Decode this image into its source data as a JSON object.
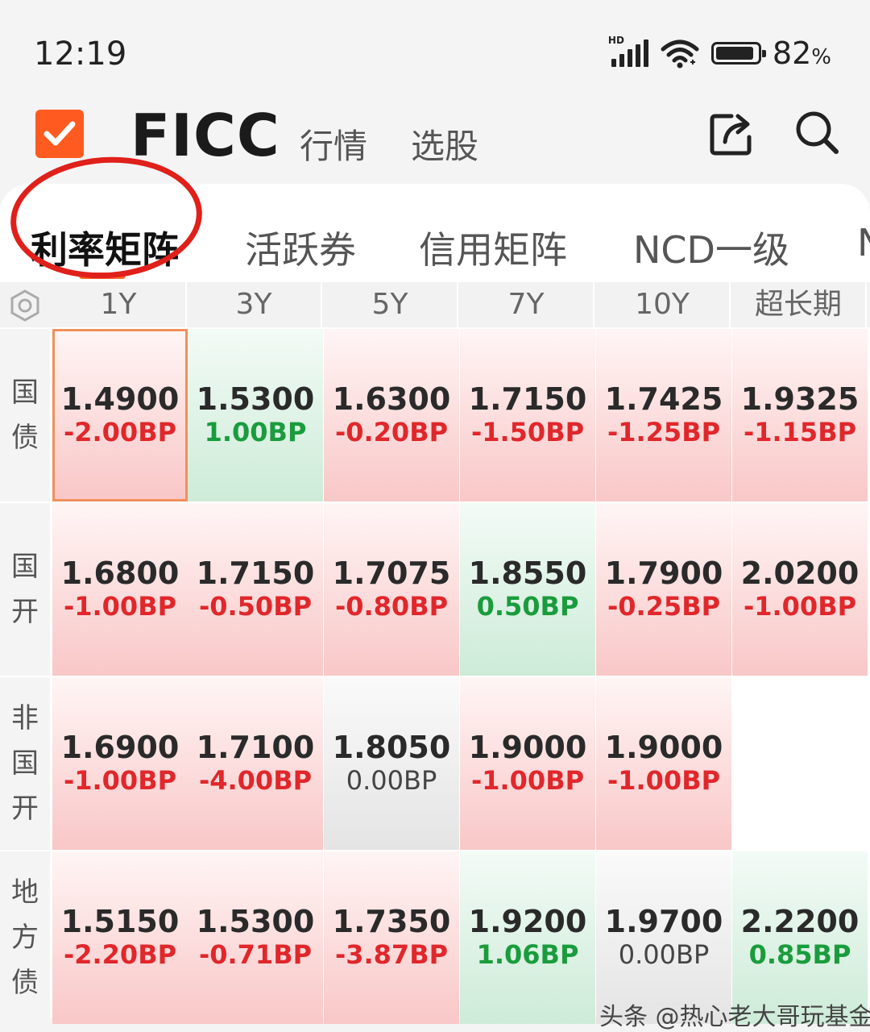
{
  "status_bar": {
    "time": "12:19",
    "network": "HD",
    "battery": "82",
    "battery_unit": "%"
  },
  "header": {
    "title": "FICC",
    "tabs": [
      "行情",
      "选股"
    ]
  },
  "subtabs": [
    {
      "label": "利率矩阵"
    },
    {
      "label": "活跃券"
    },
    {
      "label": "信用矩阵"
    },
    {
      "label": "NCD一级"
    },
    {
      "label": "N"
    }
  ],
  "matrix": {
    "columns": [
      "1Y",
      "3Y",
      "5Y",
      "7Y",
      "10Y",
      "超长期"
    ],
    "rows": [
      {
        "label": [
          "国",
          "债"
        ],
        "cells": [
          {
            "value": "1.4900",
            "change": "-2.00BP",
            "tone": "red"
          },
          {
            "value": "1.5300",
            "change": "1.00BP",
            "tone": "green"
          },
          {
            "value": "1.6300",
            "change": "-0.20BP",
            "tone": "red"
          },
          {
            "value": "1.7150",
            "change": "-1.50BP",
            "tone": "red"
          },
          {
            "value": "1.7425",
            "change": "-1.25BP",
            "tone": "red"
          },
          {
            "value": "1.9325",
            "change": "-1.15BP",
            "tone": "red"
          }
        ]
      },
      {
        "label": [
          "国",
          "开"
        ],
        "cells": [
          {
            "value": "1.6800",
            "change": "-1.00BP",
            "tone": "red"
          },
          {
            "value": "1.7150",
            "change": "-0.50BP",
            "tone": "red"
          },
          {
            "value": "1.7075",
            "change": "-0.80BP",
            "tone": "red"
          },
          {
            "value": "1.8550",
            "change": "0.50BP",
            "tone": "green"
          },
          {
            "value": "1.7900",
            "change": "-0.25BP",
            "tone": "red"
          },
          {
            "value": "2.0200",
            "change": "-1.00BP",
            "tone": "red"
          }
        ]
      },
      {
        "label": [
          "非",
          "国",
          "开"
        ],
        "cells": [
          {
            "value": "1.6900",
            "change": "-1.00BP",
            "tone": "red"
          },
          {
            "value": "1.7100",
            "change": "-4.00BP",
            "tone": "red"
          },
          {
            "value": "1.8050",
            "change": "0.00BP",
            "tone": "grey"
          },
          {
            "value": "1.9000",
            "change": "-1.00BP",
            "tone": "red"
          },
          {
            "value": "1.9000",
            "change": "-1.00BP",
            "tone": "red"
          },
          {
            "value": "",
            "change": "",
            "tone": "empty"
          }
        ]
      },
      {
        "label": [
          "地",
          "方",
          "债"
        ],
        "cells": [
          {
            "value": "1.5150",
            "change": "-2.20BP",
            "tone": "red"
          },
          {
            "value": "1.5300",
            "change": "-0.71BP",
            "tone": "red"
          },
          {
            "value": "1.7350",
            "change": "-3.87BP",
            "tone": "red"
          },
          {
            "value": "1.9200",
            "change": "1.06BP",
            "tone": "green"
          },
          {
            "value": "1.9700",
            "change": "0.00BP",
            "tone": "grey"
          },
          {
            "value": "2.2200",
            "change": "0.85BP",
            "tone": "green"
          }
        ]
      }
    ]
  },
  "watermark": "头条 @热心老大哥玩基金",
  "colors": {
    "accent": "#ff6a2a",
    "up": "#e0272b",
    "down": "#1a9c3c",
    "annotation": "#e0201a"
  },
  "icons": [
    "check-logo-icon",
    "share-icon",
    "search-icon",
    "settings-icon",
    "signal-icon",
    "wifi-icon",
    "battery-icon"
  ]
}
